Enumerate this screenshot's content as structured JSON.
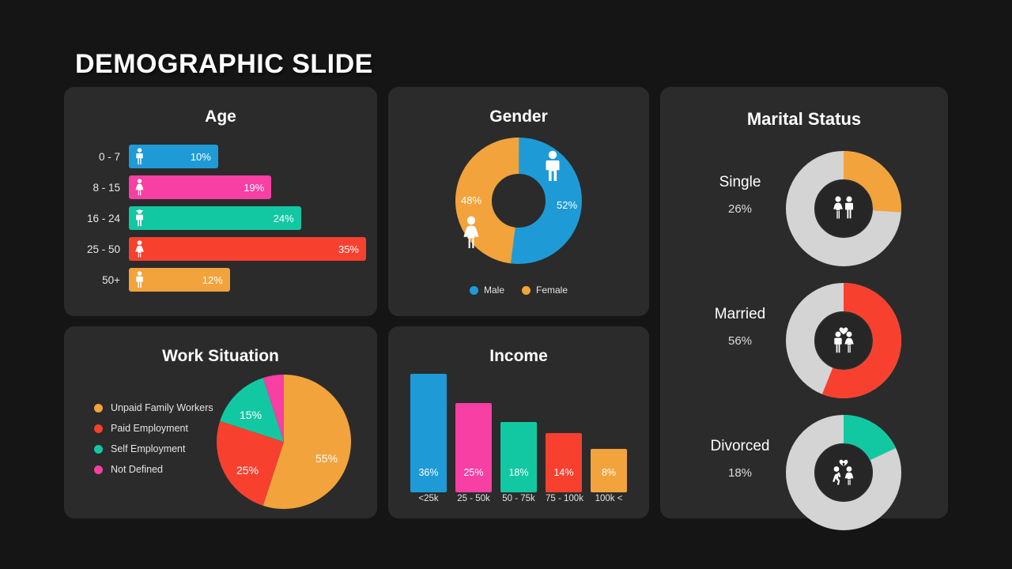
{
  "slide": {
    "title": "DEMOGRAPHIC SLIDE",
    "background": "#151515",
    "card_background": "#2b2b2b"
  },
  "palette": {
    "blue": "#1e9bd7",
    "pink": "#f73fa4",
    "teal": "#12c8a3",
    "red": "#f8402f",
    "orange": "#f2a33c",
    "gray_track": "#d4d4d4",
    "hub": "#262626"
  },
  "cards": {
    "age": {
      "title": "Age"
    },
    "gender": {
      "title": "Gender"
    },
    "marital": {
      "title": "Marital Status"
    },
    "work": {
      "title": "Work Situation"
    },
    "income": {
      "title": "Income"
    }
  },
  "chart_data": [
    {
      "type": "bar",
      "title": "Age",
      "orientation": "horizontal",
      "categories": [
        "0 - 7",
        "8 - 15",
        "16 - 24",
        "25 - 50",
        "50+"
      ],
      "values": [
        10,
        19,
        24,
        35,
        12
      ],
      "value_labels": [
        "10%",
        "19%",
        "24%",
        "35%",
        "12%"
      ],
      "colors": [
        "#1e9bd7",
        "#f73fa4",
        "#12c8a3",
        "#f8402f",
        "#f2a33c"
      ],
      "icons": [
        "child-icon",
        "girl-icon",
        "teen-icon",
        "adult-icon",
        "senior-icon"
      ],
      "xlabel": "",
      "ylabel": "",
      "grid": false
    },
    {
      "type": "pie",
      "variant": "donut",
      "title": "Gender",
      "categories": [
        "Male",
        "Female"
      ],
      "values": [
        52,
        48
      ],
      "value_labels": [
        "52%",
        "48%"
      ],
      "colors": [
        "#1e9bd7",
        "#f2a33c"
      ],
      "legend": [
        "Male",
        "Female"
      ],
      "legend_position": "bottom"
    },
    {
      "type": "pie",
      "variant": "gauge-rings",
      "title": "Marital Status",
      "categories": [
        "Single",
        "Married",
        "Divorced"
      ],
      "values": [
        26,
        56,
        18
      ],
      "value_labels": [
        "26%",
        "56%",
        "18%"
      ],
      "colors": [
        "#f2a33c",
        "#f8402f",
        "#12c8a3"
      ],
      "track_color": "#d4d4d4",
      "icons": [
        "single-couple-icon",
        "married-couple-heart-icon",
        "divorced-couple-broken-heart-icon"
      ]
    },
    {
      "type": "pie",
      "title": "Work Situation",
      "categories": [
        "Unpaid Family Workers",
        "Paid Employment",
        "Self Employment",
        "Not Defined"
      ],
      "values": [
        55,
        25,
        15,
        5
      ],
      "value_labels": [
        "55%",
        "25%",
        "15%",
        ""
      ],
      "colors": [
        "#f2a33c",
        "#f8402f",
        "#12c8a3",
        "#f73fa4"
      ],
      "legend_position": "left"
    },
    {
      "type": "bar",
      "title": "Income",
      "orientation": "vertical",
      "categories": [
        "<25k",
        "25 - 50k",
        "50 - 75k",
        "75 - 100k",
        "100k <"
      ],
      "values": [
        36,
        25,
        18,
        14,
        8
      ],
      "value_labels": [
        "36%",
        "25%",
        "18%",
        "14%",
        "8%"
      ],
      "colors": [
        "#1e9bd7",
        "#f73fa4",
        "#12c8a3",
        "#f8402f",
        "#f2a33c"
      ],
      "xlabel": "",
      "ylabel": "",
      "grid": false
    }
  ]
}
